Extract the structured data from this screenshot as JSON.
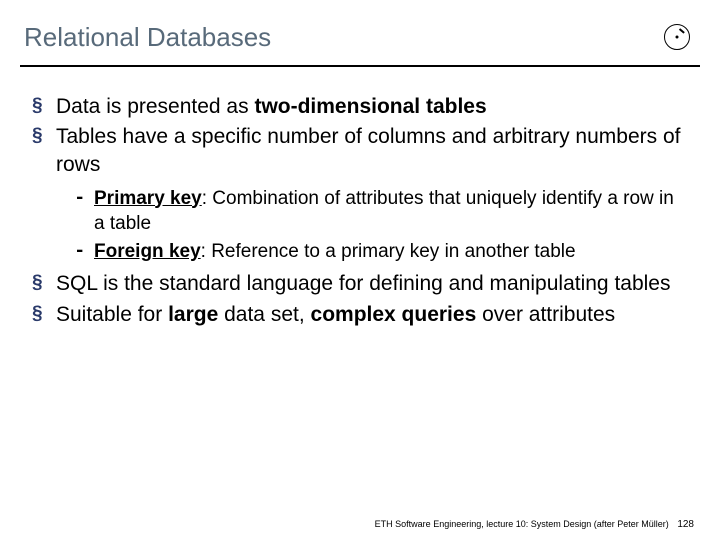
{
  "title": "Relational Databases",
  "bullets": {
    "b1_pre": "Data is presented as ",
    "b1_bold": "two-dimensional tables",
    "b2": "Tables have a specific number of columns and arbitrary numbers of rows",
    "s1_key": "Primary key",
    "s1_rest": ": Combination of attributes that uniquely identify a row in a table",
    "s2_key": "Foreign key",
    "s2_rest": ": Reference to a primary key in another table",
    "b3": "SQL is the standard language for defining and manipulating tables",
    "b4_a": "Suitable for ",
    "b4_b": "large",
    "b4_c": " data set, ",
    "b4_d": "complex queries",
    "b4_e": " over attributes"
  },
  "footer": {
    "text": "ETH Software Engineering, lecture 10: System Design (after Peter Müller)",
    "page": "128"
  }
}
